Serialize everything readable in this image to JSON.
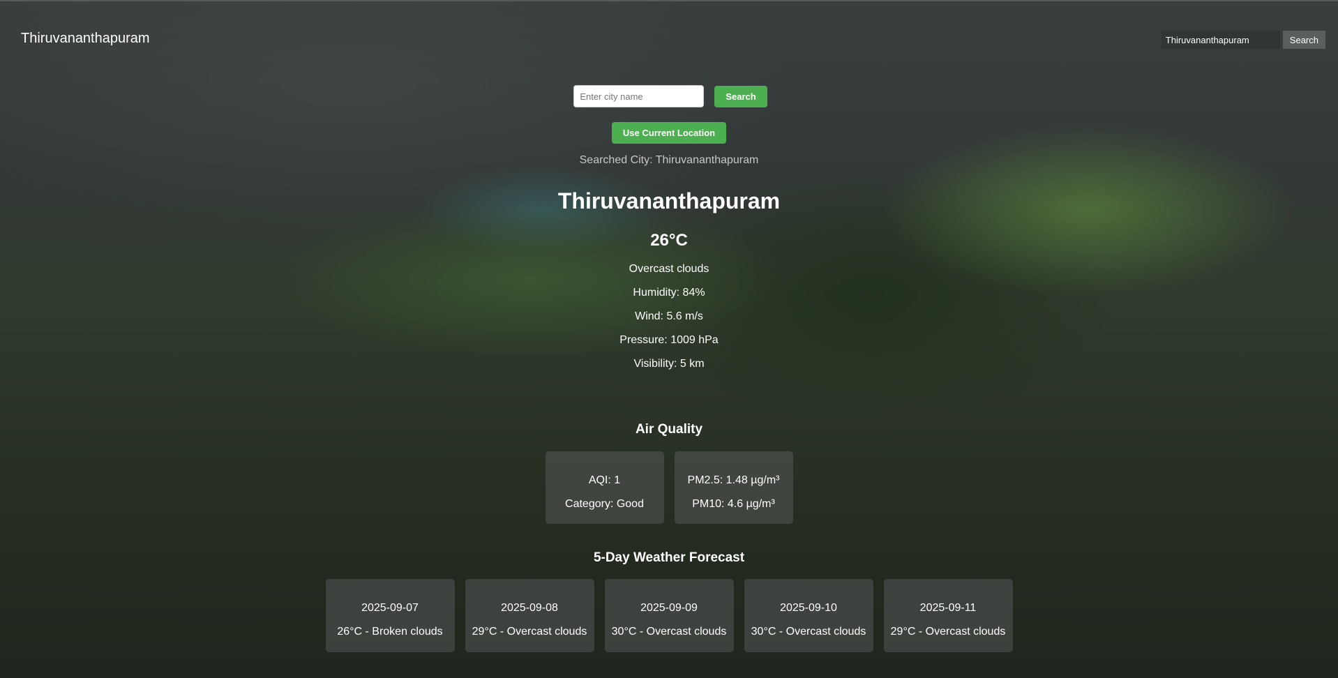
{
  "header": {
    "title": "Thiruvananthapuram",
    "search_value": "Thiruvananthapuram",
    "search_button": "Search"
  },
  "search": {
    "placeholder": "Enter city name",
    "button": "Search",
    "location_button": "Use Current Location"
  },
  "searched_city": "Searched City: Thiruvananthapuram",
  "weather": {
    "city": "Thiruvananthapuram",
    "temperature": "26°C",
    "description": "Overcast clouds",
    "humidity": "Humidity: 84%",
    "wind": "Wind: 5.6 m/s",
    "pressure": "Pressure: 1009 hPa",
    "visibility": "Visibility: 5 km"
  },
  "air_quality": {
    "title": "Air Quality",
    "aqi": "AQI: 1",
    "category": "Category: Good",
    "pm25": "PM2.5: 1.48 µg/m³",
    "pm10": "PM10: 4.6 µg/m³"
  },
  "forecast": {
    "title": "5-Day Weather Forecast",
    "days": [
      {
        "date": "2025-09-07",
        "summary": "26°C - Broken clouds"
      },
      {
        "date": "2025-09-08",
        "summary": "29°C - Overcast clouds"
      },
      {
        "date": "2025-09-09",
        "summary": "30°C - Overcast clouds"
      },
      {
        "date": "2025-09-10",
        "summary": "30°C - Overcast clouds"
      },
      {
        "date": "2025-09-11",
        "summary": "29°C - Overcast clouds"
      }
    ]
  },
  "colors": {
    "accent_green": "#4caf50",
    "card_bg": "#555858"
  }
}
